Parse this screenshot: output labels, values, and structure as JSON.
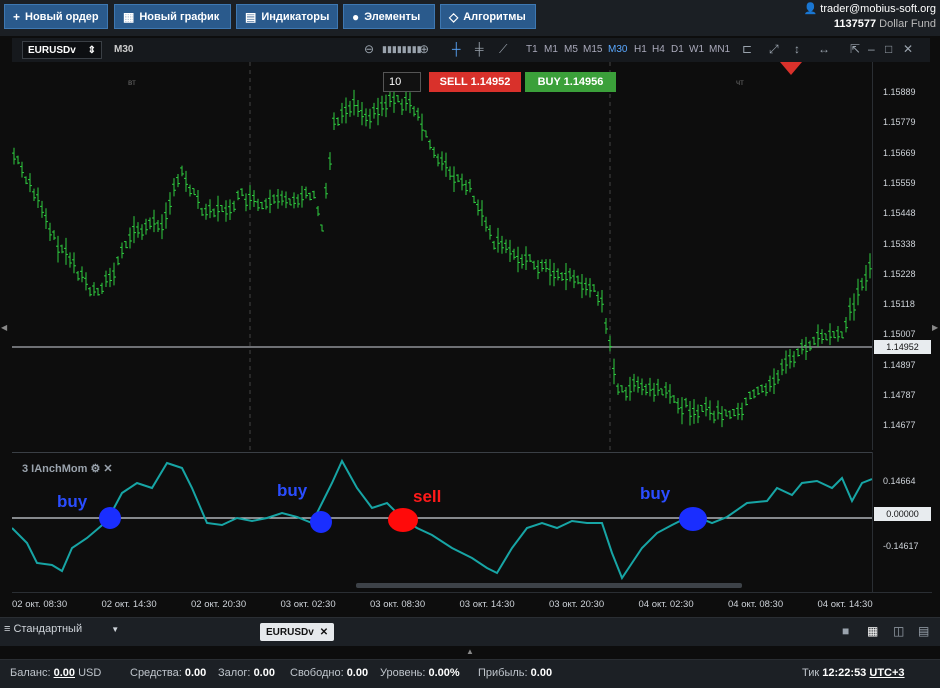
{
  "toolbar": {
    "new_order": "Новый ордер",
    "new_chart": "Новый график",
    "indicators": "Индикаторы",
    "elements": "Элементы",
    "algorithms": "Алгоритмы"
  },
  "account": {
    "user": "trader@mobius-soft.org",
    "number": "1137577",
    "fund": "Dollar Fund"
  },
  "chart": {
    "symbol": "EURUSDv",
    "timeframe": "M30",
    "timeframes": [
      "T1",
      "M1",
      "M5",
      "M15",
      "M30",
      "H1",
      "H4",
      "D1",
      "W1",
      "MN1"
    ],
    "active_timeframe": "M30",
    "quantity": "10",
    "sell_label": "SELL 1.14952",
    "buy_label": "BUY 1.14956",
    "day_labels": [
      "вт",
      "чт"
    ],
    "price_labels": [
      "1.15889",
      "1.15779",
      "1.15669",
      "1.15559",
      "1.15448",
      "1.15338",
      "1.15228",
      "1.15118",
      "1.15007",
      "1.14897",
      "1.14787",
      "1.14677"
    ],
    "current_price": "1.14952",
    "candle_color": "#2ecc40",
    "accent_sell": "#d9312b",
    "accent_buy": "#3ba03a"
  },
  "indicator": {
    "title": "3 IAnchMom",
    "levels": [
      "0.14664",
      "0.00000",
      "-0.14617"
    ],
    "signals": [
      "buy",
      "buy",
      "sell",
      "buy"
    ],
    "line_color": "#17a5a5"
  },
  "time_axis": [
    "02 окт. 08:30",
    "02 окт. 14:30",
    "02 окт. 20:30",
    "03 окт. 02:30",
    "03 окт. 08:30",
    "03 окт. 14:30",
    "03 окт. 20:30",
    "04 окт. 02:30",
    "04 окт. 08:30",
    "04 окт. 14:30"
  ],
  "tabs": {
    "template": "Стандартный",
    "chart_tab": "EURUSDv"
  },
  "status": {
    "balance_label": "Баланс:",
    "balance_value": "0.00",
    "currency": "USD",
    "equity_label": "Средства:",
    "equity_value": "0.00",
    "margin_label": "Залог:",
    "margin_value": "0.00",
    "free_label": "Свободно:",
    "free_value": "0.00",
    "level_label": "Уровень:",
    "level_value": "0.00%",
    "profit_label": "Прибыль:",
    "profit_value": "0.00",
    "tick_label": "Тик",
    "time": "12:22:53",
    "timezone": "UTC+3"
  }
}
